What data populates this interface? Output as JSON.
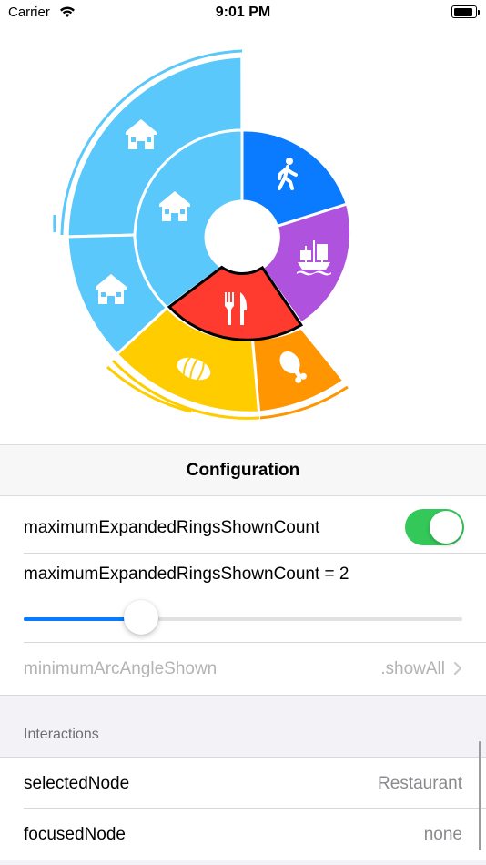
{
  "status_bar": {
    "carrier": "Carrier",
    "time": "9:01 PM"
  },
  "sunburst": {
    "inner": [
      {
        "name": "walking",
        "color": "#0a7aff",
        "icon": "walking-person-icon"
      },
      {
        "name": "ship",
        "color": "#af52de",
        "icon": "ship-icon"
      },
      {
        "name": "restaurant",
        "color": "#ff3b30",
        "icon": "fork-knife-icon",
        "selected": true
      },
      {
        "name": "bakery",
        "color": "#ffcc00",
        "icon": "croissant-icon"
      },
      {
        "name": "food",
        "color": "#ff9500",
        "icon": "drumstick-icon"
      },
      {
        "name": "house",
        "color": "#5ac8fa",
        "icon": "house-icon"
      }
    ]
  },
  "config": {
    "title": "Configuration",
    "toggle_label": "maximumExpandedRingsShownCount",
    "toggle_on": true,
    "slider_label": "maximumExpandedRingsShownCount = 2",
    "slider_value": 0.25,
    "min_arc_label": "minimumArcAngleShown",
    "min_arc_value": ".showAll"
  },
  "interactions": {
    "title": "Interactions",
    "selected_label": "selectedNode",
    "selected_value": "Restaurant",
    "focused_label": "focusedNode",
    "focused_value": "none"
  }
}
